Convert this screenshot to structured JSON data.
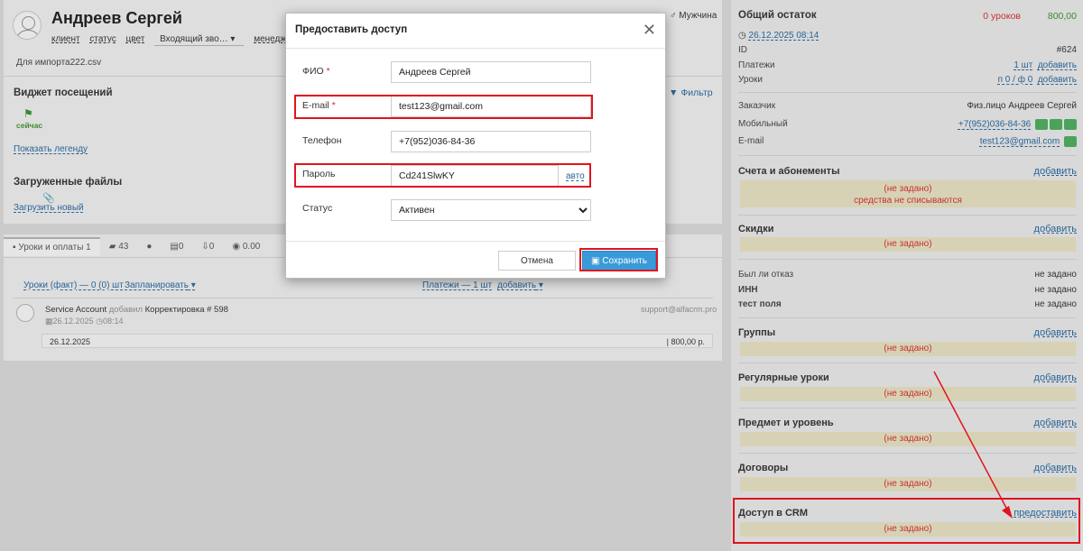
{
  "student": {
    "name": "Андреев Сергей",
    "meta": [
      "клиент",
      "статус",
      "цвет"
    ],
    "lead_source": "Входящий зво…",
    "manager_label": "менеджер",
    "gender": "Мужчина",
    "import_note": "Для импорта222.csv"
  },
  "visits_widget": {
    "title": "Виджет посещений",
    "now_label": "сейчас",
    "legend_link": "Показать легенду",
    "filter_label": "Фильтр"
  },
  "files": {
    "title": "Загруженные файлы",
    "upload_link": "Загрузить новый"
  },
  "tabs": [
    {
      "icon": "book-icon",
      "label": "Уроки и оплаты 1"
    },
    {
      "icon": "comments-icon",
      "label": "43"
    },
    {
      "icon": "whatsapp-icon",
      "label": ""
    },
    {
      "icon": "document-icon",
      "label": "0"
    },
    {
      "icon": "download-icon",
      "label": "0"
    },
    {
      "icon": "money-icon",
      "label": "0.00"
    }
  ],
  "lessons": {
    "fact_label": "Уроки (факт) — 0 (0) шт",
    "plan_label": "Запланировать",
    "payments_label": "Платежи — 1 шт",
    "add_label": "добавить",
    "entry_author": "Service Account",
    "entry_action": "добавил",
    "entry_text": "Корректировка # 598",
    "entry_date": "26.12.2025",
    "entry_time": "08:14",
    "entry_email": "support@alfacrm.pro",
    "entry_row_date": "26.12.2025",
    "entry_amount": "800,00 р."
  },
  "right": {
    "balance_title": "Общий остаток",
    "balance_lessons": "0 уроков",
    "balance_amount": "800,00",
    "date": "26.12.2025 08:14",
    "rows": [
      {
        "label": "ID",
        "value": "#624"
      },
      {
        "label": "Платежи",
        "value": "1 шт",
        "extra": "добавить"
      },
      {
        "label": "Уроки",
        "value": "п 0 / ф 0",
        "extra": "добавить"
      },
      {
        "label": "Заказчик",
        "value": "Физ.лицо Андреев Сергей"
      },
      {
        "label": "Мобильный",
        "value": "+7(952)036-84-36"
      },
      {
        "label": "E-mail",
        "value": "test123@gmail.com"
      }
    ],
    "sections": [
      {
        "title": "Счета и абонементы",
        "add": "добавить",
        "empty": "(не задано)",
        "note": "средства не списываются"
      },
      {
        "title": "Скидки",
        "add": "добавить",
        "empty": "(не задано)"
      },
      {
        "title": "Группы",
        "add": "добавить",
        "empty": "(не задано)"
      },
      {
        "title": "Регулярные уроки",
        "add": "добавить",
        "empty": "(не задано)"
      },
      {
        "title": "Предмет и уровень",
        "add": "добавить",
        "empty": "(не задано)"
      },
      {
        "title": "Договоры",
        "add": "добавить",
        "empty": "(не задано)"
      },
      {
        "title": "Доступ в CRM",
        "add": "предоставить",
        "empty": "(не задано)"
      }
    ],
    "extra_fields": [
      {
        "label": "Был ли отказ",
        "value": "не задано"
      },
      {
        "label": "ИНН",
        "value": "не задано"
      },
      {
        "label": "тест поля",
        "value": "не задано"
      }
    ]
  },
  "dialog": {
    "title": "Предоставить доступ",
    "fio_label": "ФИО",
    "fio_value": "Андреев Сергей",
    "email_label": "E-mail",
    "email_value": "test123@gmail.com",
    "phone_label": "Телефон",
    "phone_value": "+7(952)036-84-36",
    "password_label": "Пароль",
    "password_value": "Cd241SlwKY",
    "auto_label": "авто",
    "status_label": "Статус",
    "status_value": "Активен",
    "required_mark": "*",
    "cancel_label": "Отмена",
    "save_label": "Сохранить"
  },
  "colors": {
    "highlight": "#e0141e",
    "primary": "#3a9ad9",
    "negative": "#c9302c",
    "positive": "#3c8a2e",
    "empty_bg": "#d7d2b6"
  }
}
